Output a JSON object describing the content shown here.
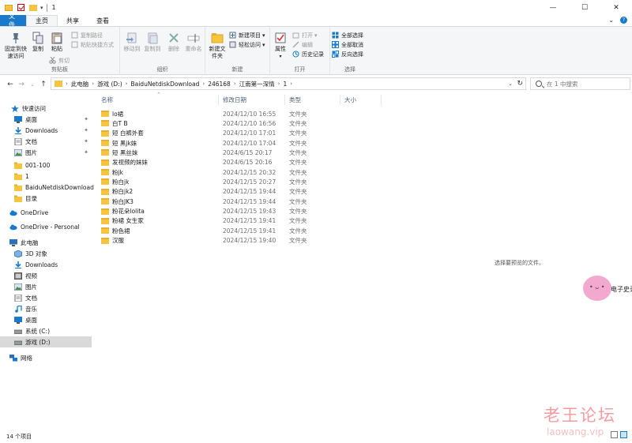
{
  "window": {
    "title": "1",
    "minimize": "—",
    "maximize": "☐",
    "close": "✕"
  },
  "tabs": [
    "文件",
    "主页",
    "共享",
    "查看"
  ],
  "ribbon": {
    "clipboard": {
      "pin_label": "固定到快速访问",
      "copy_label": "复制",
      "paste_label": "粘贴",
      "copy_path": "复制路径",
      "paste_shortcut": "粘贴快捷方式",
      "cut": "剪切",
      "group": "剪贴板"
    },
    "organize": {
      "move_to": "移动到",
      "copy_to": "复制到",
      "delete": "删除",
      "rename": "重命名",
      "group": "组织"
    },
    "new": {
      "new_folder": "新建文件夹",
      "new_item": "新建项目",
      "easy_access": "轻松访问",
      "group": "新建"
    },
    "open": {
      "properties": "属性",
      "open": "打开",
      "edit": "编辑",
      "history": "历史记录",
      "group": "打开"
    },
    "select": {
      "select_all": "全部选择",
      "select_none": "全部取消",
      "invert": "反向选择",
      "group": "选择"
    }
  },
  "address": {
    "crumbs": [
      "此电脑",
      "游戏 (D:)",
      "BaiduNetdiskDownload",
      "246168",
      "江南第一深情",
      "1"
    ],
    "search_placeholder": "在 1 中搜索"
  },
  "sidebar": {
    "items": [
      {
        "label": "快速访问",
        "icon": "star-icon"
      },
      {
        "label": "桌面",
        "icon": "desktop-icon",
        "pinned": true
      },
      {
        "label": "Downloads",
        "icon": "download-icon",
        "pinned": true
      },
      {
        "label": "文档",
        "icon": "document-icon",
        "pinned": true
      },
      {
        "label": "图片",
        "icon": "picture-icon",
        "pinned": true
      },
      {
        "label": "001-100",
        "icon": "folder-icon"
      },
      {
        "label": "1",
        "icon": "folder-icon"
      },
      {
        "label": "BaiduNetdiskDownload",
        "icon": "folder-icon"
      },
      {
        "label": "目录",
        "icon": "folder-icon"
      },
      {
        "label": "OneDrive",
        "icon": "cloud-icon"
      },
      {
        "label": "OneDrive - Personal",
        "icon": "cloud-icon"
      },
      {
        "label": "此电脑",
        "icon": "computer-icon"
      },
      {
        "label": "3D 对象",
        "icon": "cube-icon"
      },
      {
        "label": "Downloads",
        "icon": "download-icon"
      },
      {
        "label": "视频",
        "icon": "video-icon"
      },
      {
        "label": "图片",
        "icon": "picture-icon"
      },
      {
        "label": "文档",
        "icon": "document-icon"
      },
      {
        "label": "音乐",
        "icon": "music-icon"
      },
      {
        "label": "桌面",
        "icon": "desktop-icon"
      },
      {
        "label": "系统 (C:)",
        "icon": "drive-icon"
      },
      {
        "label": "游戏 (D:)",
        "icon": "drive-icon",
        "selected": true
      },
      {
        "label": "网络",
        "icon": "network-icon"
      }
    ]
  },
  "columns": {
    "name": "名称",
    "date": "修改日期",
    "type": "类型",
    "size": "大小"
  },
  "files": [
    {
      "name": "lo裙",
      "date": "2024/12/10 16:55",
      "type": "文件夹"
    },
    {
      "name": "白T B",
      "date": "2024/12/10 16:56",
      "type": "文件夹"
    },
    {
      "name": "短 白裤外套",
      "date": "2024/12/10 17:01",
      "type": "文件夹"
    },
    {
      "name": "短 黑jk妹",
      "date": "2024/12/10 17:04",
      "type": "文件夹"
    },
    {
      "name": "短 黑丝妹",
      "date": "2024/6/15 20:17",
      "type": "文件夹"
    },
    {
      "name": "发视频的妹妹",
      "date": "2024/6/15 20:16",
      "type": "文件夹"
    },
    {
      "name": "粉jk",
      "date": "2024/12/15 20:32",
      "type": "文件夹"
    },
    {
      "name": "粉白jk",
      "date": "2024/12/15 20:27",
      "type": "文件夹"
    },
    {
      "name": "粉白jk2",
      "date": "2024/12/15 19:44",
      "type": "文件夹"
    },
    {
      "name": "粉白JK3",
      "date": "2024/12/15 19:44",
      "type": "文件夹"
    },
    {
      "name": "粉花朵lolita",
      "date": "2024/12/15 19:43",
      "type": "文件夹"
    },
    {
      "name": "粉裙 女生家",
      "date": "2024/12/15 19:41",
      "type": "文件夹"
    },
    {
      "name": "粉色裙",
      "date": "2024/12/15 19:41",
      "type": "文件夹"
    },
    {
      "name": "汉服",
      "date": "2024/12/15 19:40",
      "type": "文件夹"
    }
  ],
  "preview_text": "选择要预览的文件。",
  "status": "14 个项目",
  "overlay": {
    "sticker_text": "电子史录",
    "watermark_cn": "老王论坛",
    "watermark_url": "laowang.vip"
  },
  "colors": {
    "accent": "#1979ca",
    "folder": "#f5c542",
    "watermark": "#f39ca0"
  }
}
